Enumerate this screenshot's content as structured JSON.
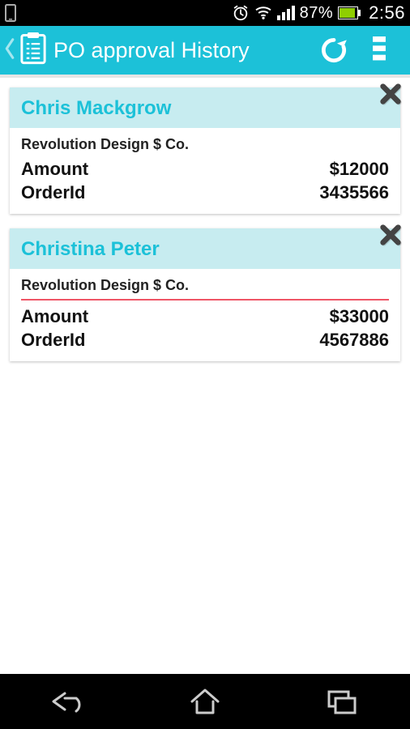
{
  "status_bar": {
    "battery_pct": "87%",
    "time": "2:56"
  },
  "app_bar": {
    "title": "PO approval History"
  },
  "cards": [
    {
      "name": "Chris Mackgrow",
      "company": "Revolution Design $ Co.",
      "amount_label": "Amount",
      "amount_value": "$12000",
      "orderid_label": "OrderId",
      "orderid_value": "3435566",
      "has_divider": false
    },
    {
      "name": "Christina Peter",
      "company": "Revolution Design $ Co.",
      "amount_label": "Amount",
      "amount_value": "$33000",
      "orderid_label": "OrderId",
      "orderid_value": "4567886",
      "has_divider": true
    }
  ]
}
